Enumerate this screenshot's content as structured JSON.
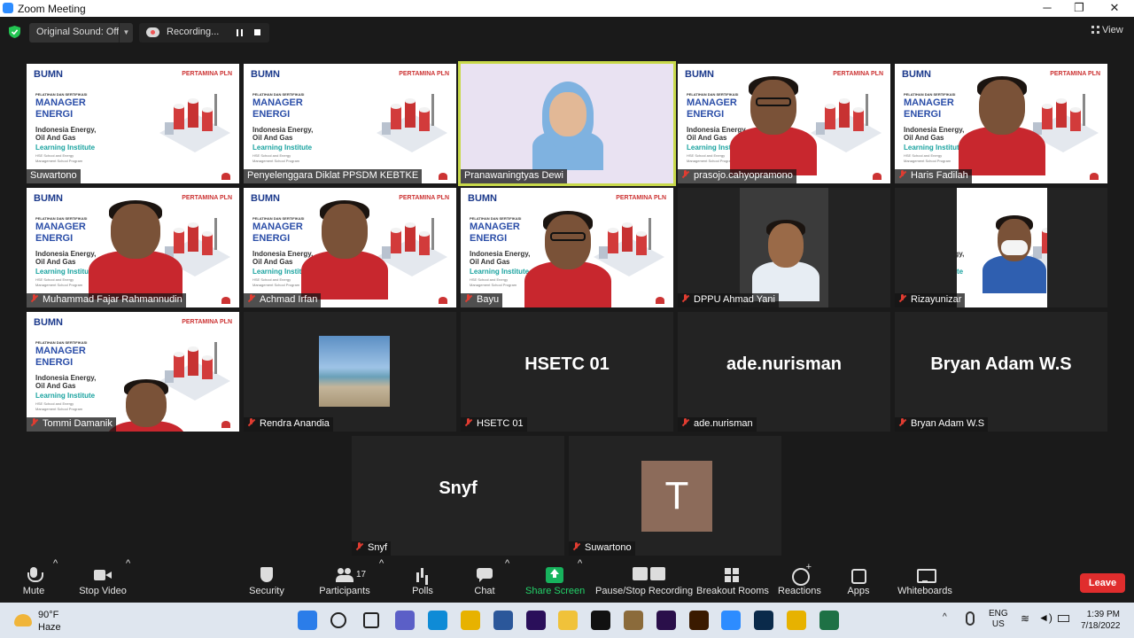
{
  "window": {
    "title": "Zoom Meeting",
    "minimize": "─",
    "maximize": "❐",
    "close": "✕"
  },
  "topbar": {
    "original_sound": "Original Sound: Off",
    "recording": "Recording...",
    "view": "View"
  },
  "slide": {
    "logo": "BUMN",
    "partners": "PERTAMINA  PLN",
    "tagline": "PELATIHAN DAN SERTIFIKASI",
    "title1": "MANAGER",
    "title2": "ENERGI",
    "sub1": "Indonesia Energy,",
    "sub2": "Oil And Gas",
    "institute": "Learning Institute",
    "small1": "HSE School and Energy",
    "small2": "Management School Program"
  },
  "participants": [
    {
      "name": "Suwartono",
      "muted": false
    },
    {
      "name": "Penyelenggara Diklat PPSDM KEBTKE",
      "muted": false
    },
    {
      "name": "Pranawaningtyas Dewi",
      "muted": false,
      "active_speaker": true
    },
    {
      "name": "prasojo.cahyopramono",
      "muted": true
    },
    {
      "name": "Haris Fadilah",
      "muted": true
    },
    {
      "name": "Muhammad Fajar Rahmannudin",
      "muted": true
    },
    {
      "name": "Achmad Irfan",
      "muted": true
    },
    {
      "name": "Bayu",
      "muted": true
    },
    {
      "name": "DPPU Ahmad Yani",
      "muted": true
    },
    {
      "name": "Rizayunizar",
      "muted": true
    },
    {
      "name": "Tommi Damanik",
      "muted": true
    },
    {
      "name": "Rendra Anandia",
      "muted": true
    },
    {
      "name": "HSETC 01",
      "muted": true,
      "display": "HSETC 01"
    },
    {
      "name": "ade.nurisman",
      "muted": true,
      "display": "ade.nurisman"
    },
    {
      "name": "Bryan Adam W.S",
      "muted": true,
      "display": "Bryan Adam W.S"
    },
    {
      "name": "Snyf",
      "muted": true,
      "display": "Snyf"
    },
    {
      "name": "Suwartono",
      "muted": true,
      "avatar_letter": "T"
    }
  ],
  "toolbar": {
    "mute": "Mute",
    "stop_video": "Stop Video",
    "security": "Security",
    "participants": "Participants",
    "participants_count": "17",
    "polls": "Polls",
    "chat": "Chat",
    "share_screen": "Share Screen",
    "pause_stop_recording": "Pause/Stop Recording",
    "breakout_rooms": "Breakout Rooms",
    "reactions": "Reactions",
    "apps": "Apps",
    "whiteboards": "Whiteboards",
    "leave": "Leave"
  },
  "taskbar": {
    "temp": "90°F",
    "weather": "Haze",
    "lang1": "ENG",
    "lang2": "US",
    "time": "1:39 PM",
    "date": "7/18/2022",
    "apps": [
      "windows-start",
      "search",
      "task-view",
      "teams",
      "edge",
      "chrome",
      "word",
      "after-effects",
      "file-explorer",
      "capcut",
      "game",
      "premiere",
      "illustrator",
      "zoom",
      "photoshop",
      "chrome-profile",
      "excel"
    ]
  },
  "colors": {
    "active_speaker": "#c8d94a",
    "leave": "#e02d2d",
    "share": "#17b35d",
    "muted_mic": "#e03c31"
  }
}
